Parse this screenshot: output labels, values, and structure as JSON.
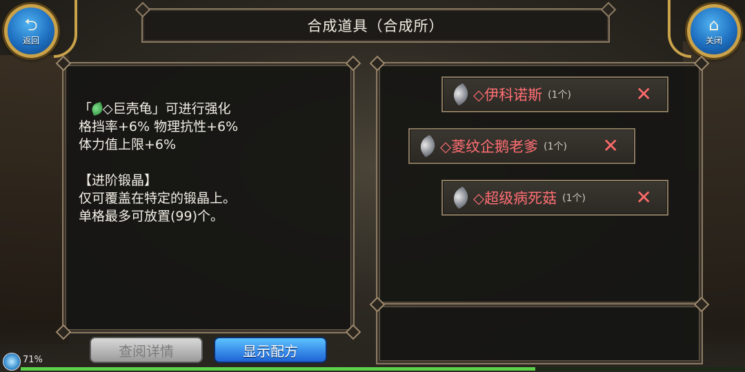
{
  "header": {
    "back_label": "返回",
    "close_label": "关闭",
    "title": "合成道具（合成所）"
  },
  "description": {
    "lines": [
      {
        "prefix": "「",
        "suffix": "◇巨壳龟」可进行强化"
      },
      {
        "text": "格挡率+6% 物理抗性+6%"
      },
      {
        "text": "体力值上限+6%"
      },
      {
        "text": ""
      },
      {
        "text": "【进阶锻晶】"
      },
      {
        "text": "仅可覆盖在特定的锻晶上。"
      },
      {
        "text": "单格最多可放置(99)个。"
      }
    ]
  },
  "ingredients": [
    {
      "name": "◇伊科诺斯",
      "count": "(1个)",
      "remove": "✕"
    },
    {
      "name": "◇菱纹企鹅老爹",
      "count": "(1个)",
      "remove": "✕"
    },
    {
      "name": "◇超级病死菇",
      "count": "(1个)",
      "remove": "✕"
    }
  ],
  "buttons": {
    "detail_label": "查阅详情",
    "recipe_label": "显示配方"
  },
  "status": {
    "battery_text": "71%",
    "progress_fraction": 0.71
  },
  "colors": {
    "ingredient_name": "#ff6f73",
    "accent_blue": "#1d63d6",
    "frame_gold": "#c9a24a"
  }
}
